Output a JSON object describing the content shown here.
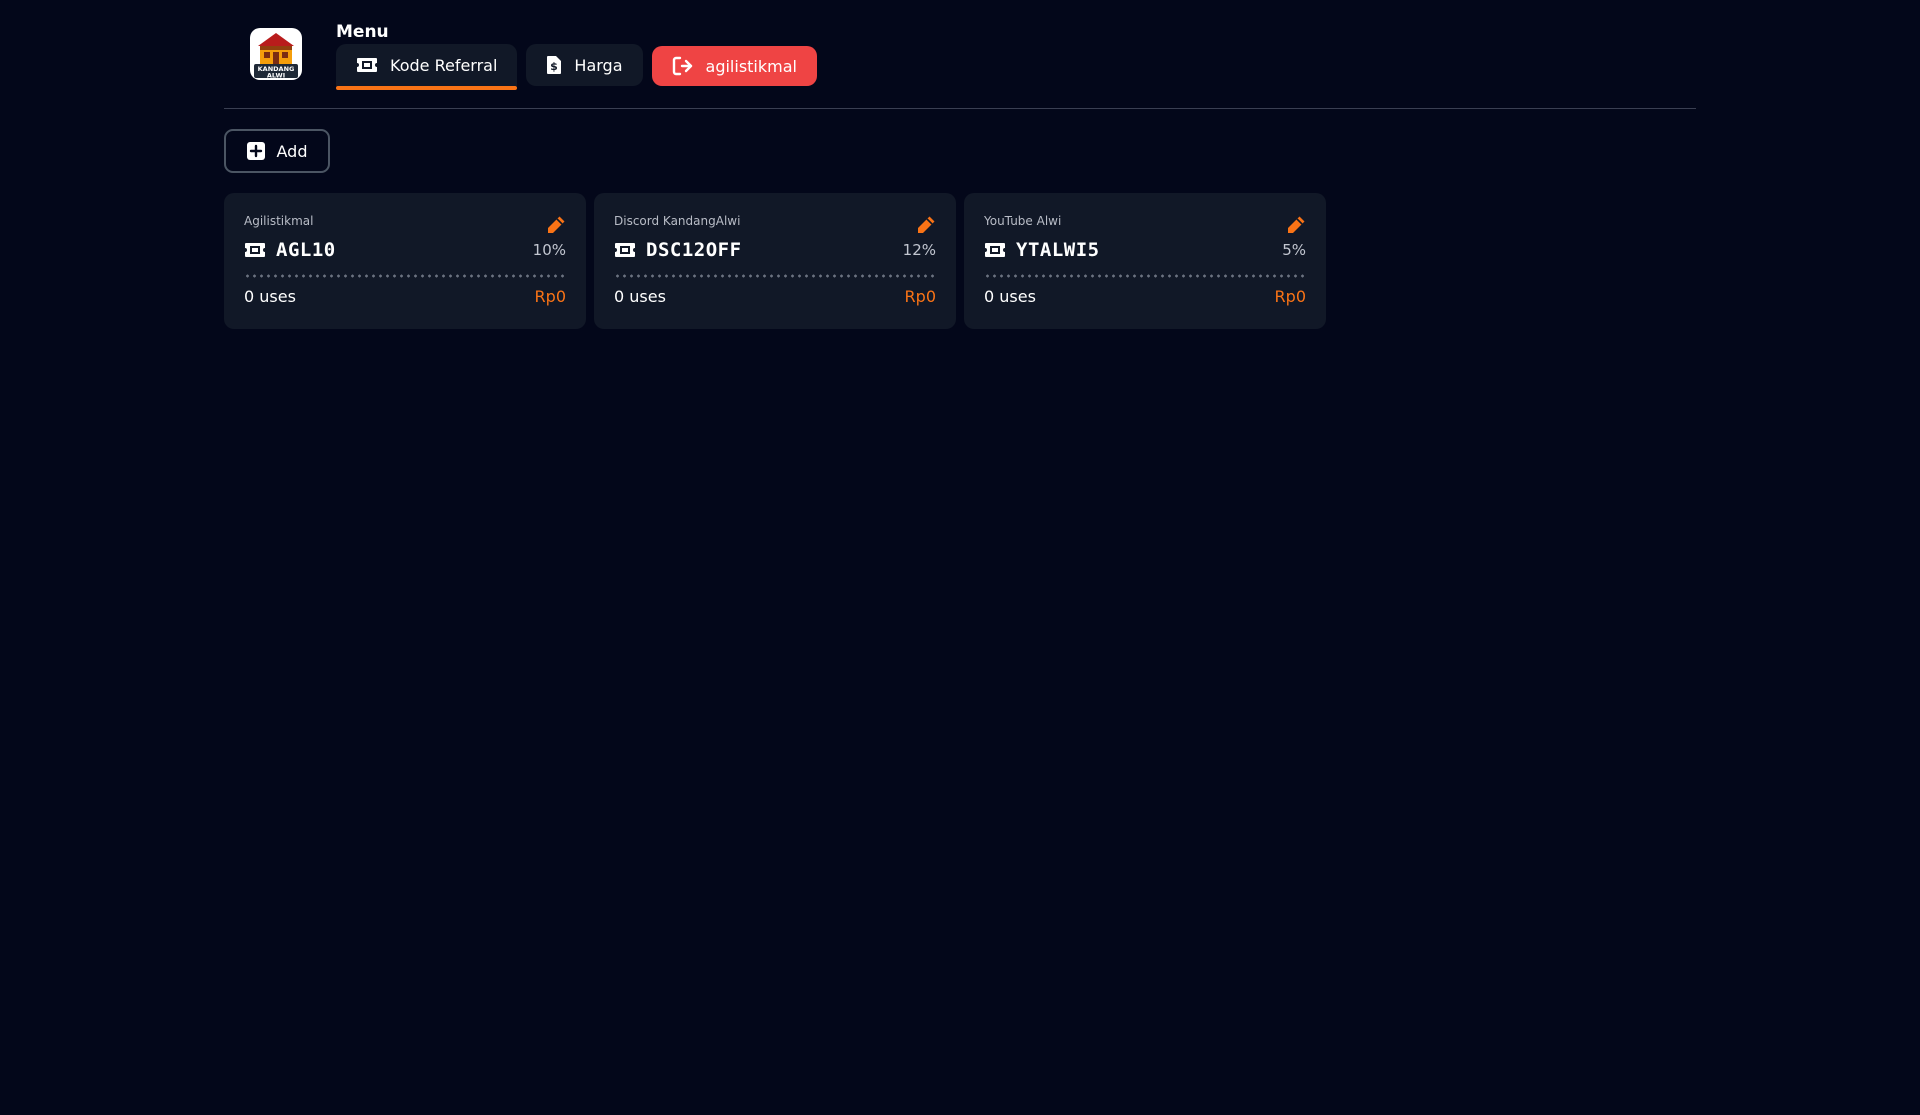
{
  "header": {
    "menu_title": "Menu",
    "logo_text_top": "KANDANG",
    "logo_text_bottom": "ALWI",
    "nav": [
      {
        "label": "Kode Referral",
        "icon": "ticket-icon",
        "active": true
      },
      {
        "label": "Harga",
        "icon": "dollar-icon",
        "active": false
      },
      {
        "label": "agilistikmal",
        "icon": "logout-icon",
        "active": false
      }
    ]
  },
  "toolbar": {
    "add_label": "Add"
  },
  "cards": [
    {
      "label": "Agilistikmal",
      "code": "AGL10",
      "percent": "10%",
      "uses": "0 uses",
      "amount": "Rp0"
    },
    {
      "label": "Discord KandangAlwi",
      "code": "DSC12OFF",
      "percent": "12%",
      "uses": "0 uses",
      "amount": "Rp0"
    },
    {
      "label": "YouTube Alwi",
      "code": "YTALWI5",
      "percent": "5%",
      "uses": "0 uses",
      "amount": "Rp0"
    }
  ],
  "colors": {
    "background": "#03071a",
    "surface": "#111827",
    "accent": "#f97316",
    "danger": "#ef4444"
  }
}
